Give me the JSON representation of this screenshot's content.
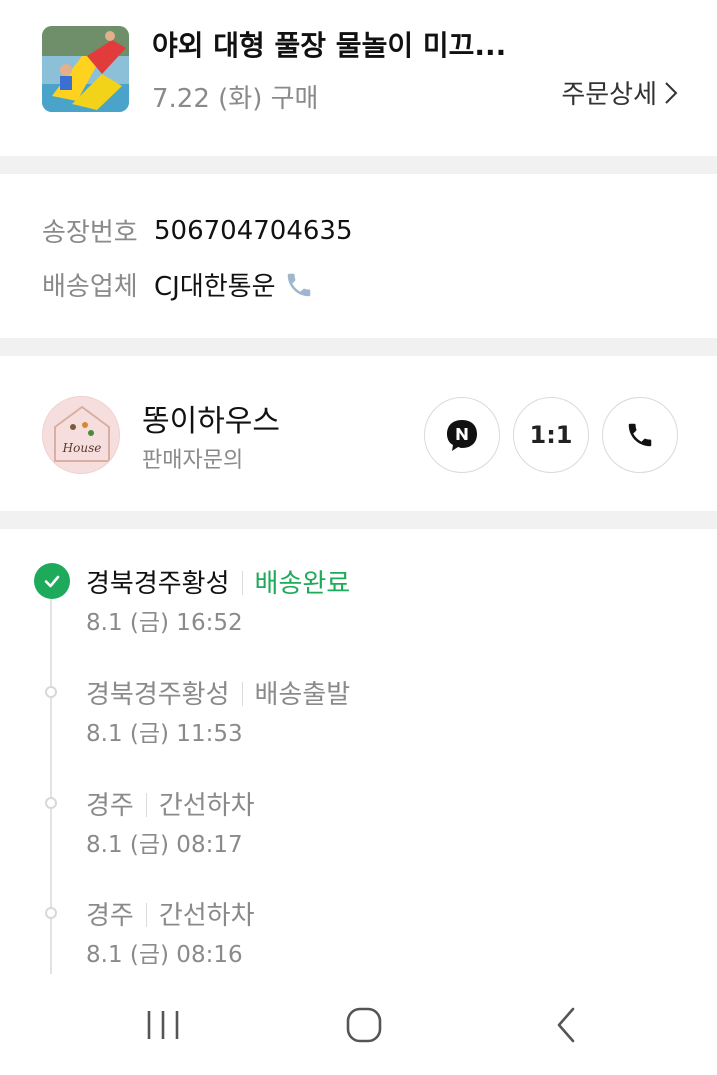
{
  "product": {
    "thumbnail_icon": "inflatable-water-slide-photo",
    "title": "야외 대형 풀장 물놀이 미끄...",
    "date": "7.22 (화) 구매",
    "order_detail_label": "주문상세"
  },
  "invoice": {
    "tracking_label": "송장번호",
    "tracking_number": "506704704635",
    "carrier_label": "배송업체",
    "carrier_name": "CJ대한통운",
    "carrier_icon": "phone-icon"
  },
  "seller": {
    "name": "똥이하우스",
    "subtitle": "판매자문의",
    "logo_text": "House",
    "buttons": [
      {
        "icon": "naver-talk-icon",
        "label": "N"
      },
      {
        "icon": "one-to-one-icon",
        "label": "1:1"
      },
      {
        "icon": "phone-icon",
        "label": ""
      }
    ]
  },
  "tracking_steps": [
    {
      "place": "경북경주황성",
      "status": "배송완료",
      "time": "8.1 (금) 16:52",
      "current": true
    },
    {
      "place": "경북경주황성",
      "status": "배송출발",
      "time": "8.1 (금) 11:53",
      "current": false
    },
    {
      "place": "경주",
      "status": "간선하차",
      "time": "8.1 (금) 08:17",
      "current": false
    },
    {
      "place": "경주",
      "status": "간선하차",
      "time": "8.1 (금) 08:16",
      "current": false
    }
  ],
  "colors": {
    "accent_green": "#1daa5a",
    "muted_text": "#8a8a8a",
    "divider": "#f1f1f1"
  },
  "navbar": {
    "items": [
      "recent-apps-icon",
      "home-icon",
      "back-icon"
    ]
  }
}
